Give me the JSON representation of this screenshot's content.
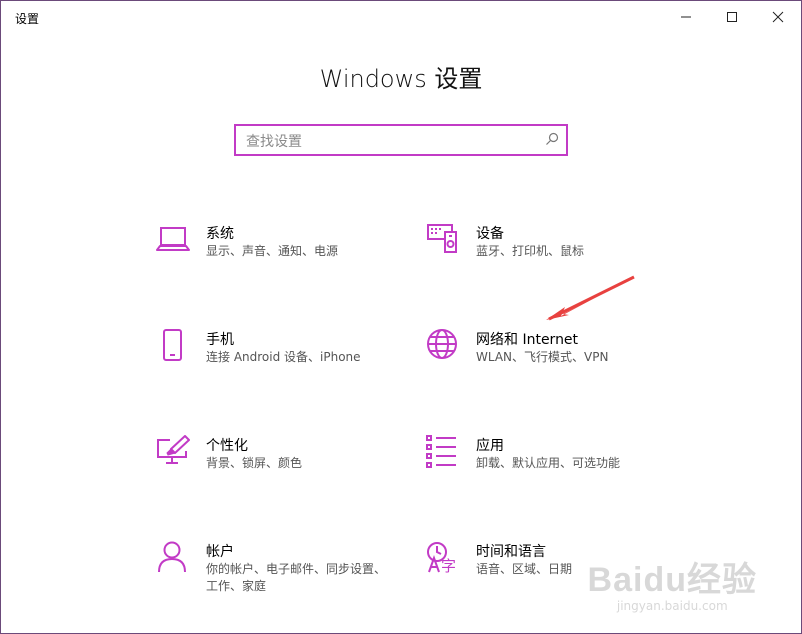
{
  "window": {
    "title": "设置"
  },
  "heading": "Windows 设置",
  "search": {
    "placeholder": "查找设置"
  },
  "tiles": [
    {
      "icon": "laptop-icon",
      "title": "系统",
      "desc": "显示、声音、通知、电源"
    },
    {
      "icon": "devices-icon",
      "title": "设备",
      "desc": "蓝牙、打印机、鼠标"
    },
    {
      "icon": "phone-icon",
      "title": "手机",
      "desc": "连接 Android 设备、iPhone"
    },
    {
      "icon": "globe-icon",
      "title": "网络和 Internet",
      "desc": "WLAN、飞行模式、VPN"
    },
    {
      "icon": "personalization-icon",
      "title": "个性化",
      "desc": "背景、锁屏、颜色"
    },
    {
      "icon": "apps-icon",
      "title": "应用",
      "desc": "卸载、默认应用、可选功能"
    },
    {
      "icon": "person-icon",
      "title": "帐户",
      "desc": "你的帐户、电子邮件、同步设置、工作、家庭"
    },
    {
      "icon": "time-language-icon",
      "title": "时间和语言",
      "desc": "语音、区域、日期"
    }
  ],
  "accent_color": "#c23bc6",
  "annotation_color": "#e8413f",
  "watermark": {
    "logo": "Baidu经验",
    "url": "jingyan.baidu.com"
  }
}
